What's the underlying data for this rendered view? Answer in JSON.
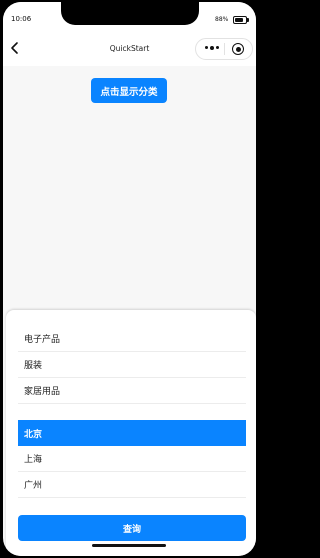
{
  "status_bar": {
    "time": "10:06",
    "battery_percent": "88%",
    "battery_level": 0.88
  },
  "nav_bar": {
    "title": "QuickStart",
    "back_icon": "chevron-left-icon",
    "more_icon": "more-dots-icon",
    "close_icon": "target-circle-icon"
  },
  "main": {
    "show_button_label": "点击显示分类"
  },
  "sheet": {
    "categories": [
      "电子产品",
      "服装",
      "家居用品"
    ],
    "cities": [
      "北京",
      "上海",
      "广州"
    ],
    "selected_city": "北京",
    "query_button_label": "查询"
  },
  "colors": {
    "accent": "#0a84ff",
    "background": "#f7f7f7"
  }
}
